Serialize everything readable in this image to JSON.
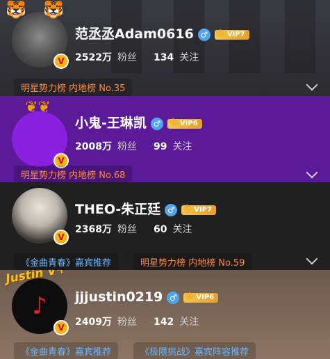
{
  "cards": [
    {
      "name": "范丞丞Adam0616",
      "vip": "VIP7",
      "fans_num": "2522万",
      "fans_label": "粉丝",
      "follow_num": "134",
      "follow_label": "关注",
      "tag1": "明星势力榜 内地榜 No.35"
    },
    {
      "name": "小鬼-王琳凯",
      "vip": "VIP6",
      "fans_num": "2008万",
      "fans_label": "粉丝",
      "follow_num": "99",
      "follow_label": "关注",
      "tag1": "明星势力榜 内地榜 No.68"
    },
    {
      "name": "THEO-朱正廷",
      "vip": "VIP7",
      "fans_num": "2368万",
      "fans_label": "粉丝",
      "follow_num": "60",
      "follow_label": "关注",
      "tag1": "《金曲青春》嘉宾推荐",
      "tag2": "明星势力榜 内地榜 No.59"
    },
    {
      "name": "jjjustin0219",
      "vip": "VIP6",
      "fans_num": "2409万",
      "fans_label": "粉丝",
      "follow_num": "142",
      "follow_label": "关注",
      "tag1": "《金曲青春》嘉宾推荐",
      "tag2": "《极限挑战》嘉宾阵容推荐",
      "frame_text": "Justin V+"
    }
  ],
  "badge_letter": "V",
  "gender_symbol": "♂",
  "icons": [
    "male-icon",
    "vip-crown-icon",
    "verified-v-icon",
    "chevron-down-icon"
  ],
  "colors": {
    "card2_bg": "#5b1a97",
    "tag_orange": "#ff8a3b",
    "tag_blue": "#6bb6ff",
    "gender_blue": "#4ea4f0"
  }
}
